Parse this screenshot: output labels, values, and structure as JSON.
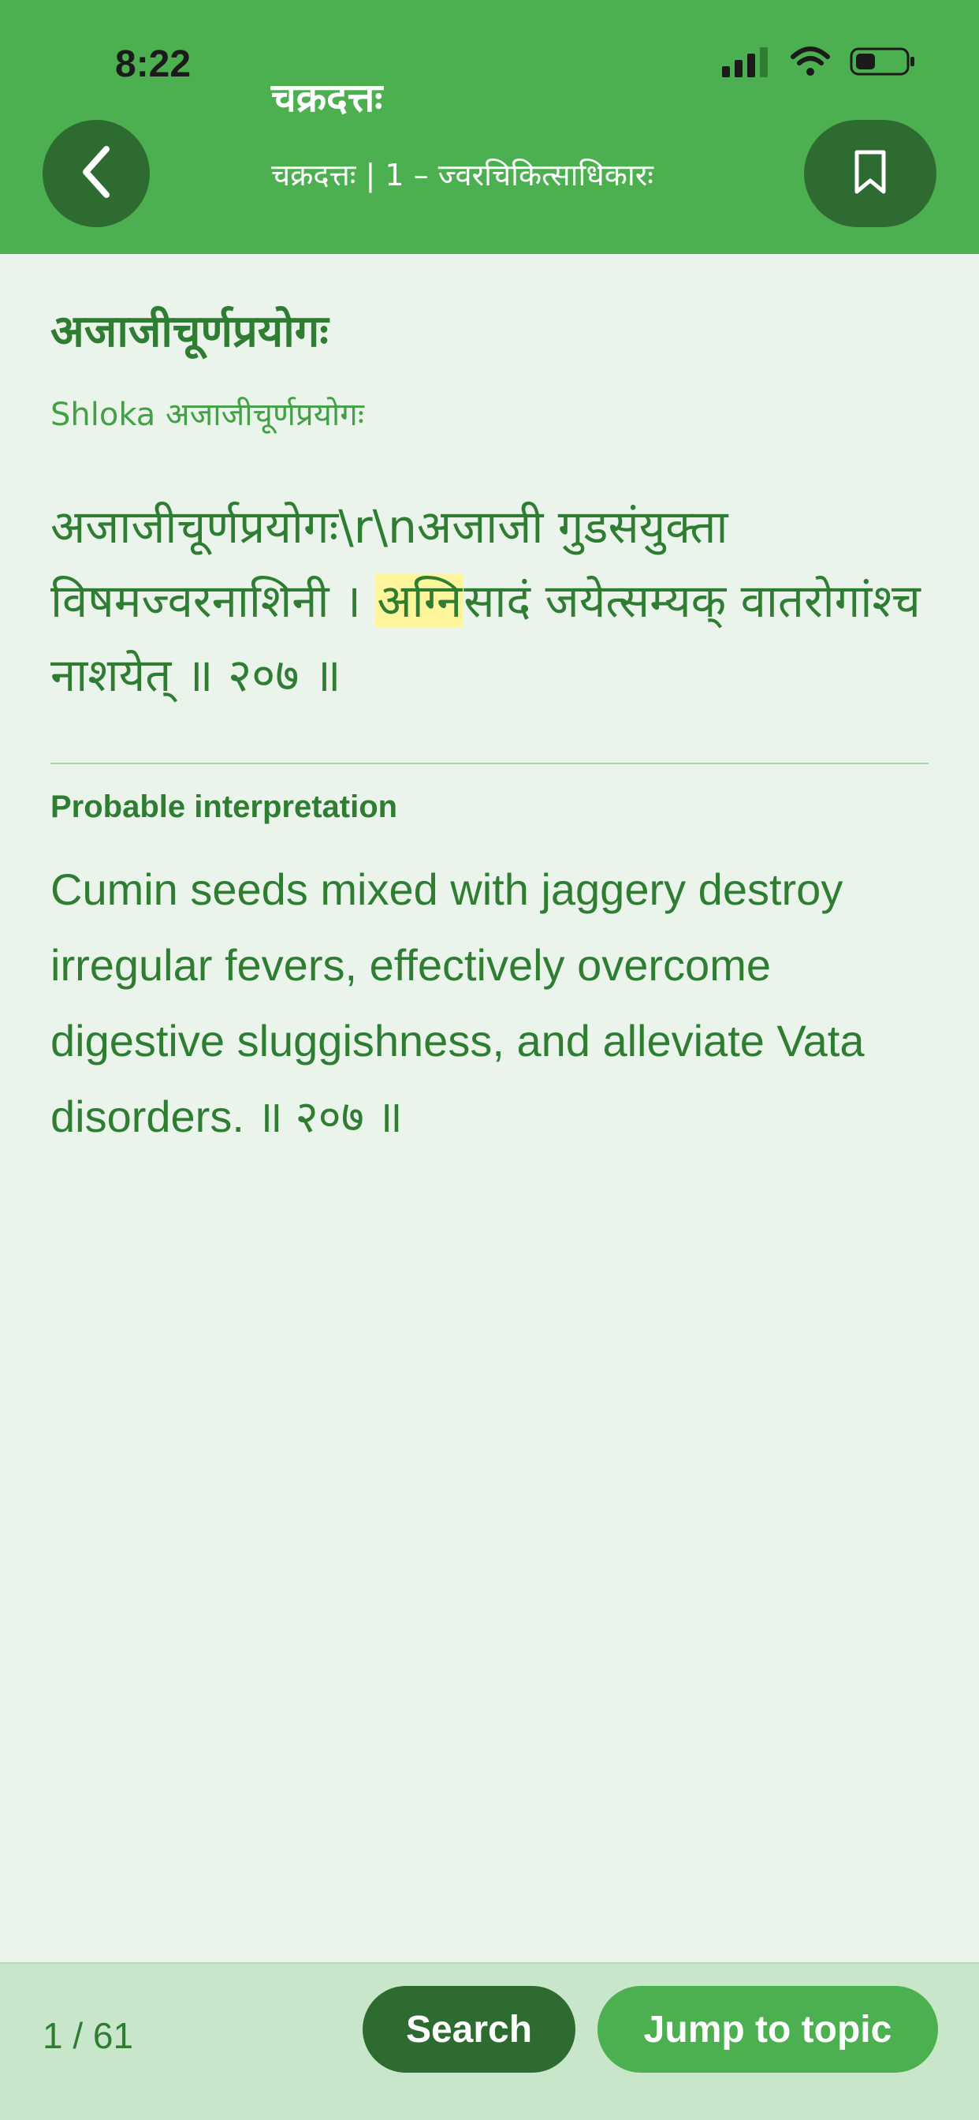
{
  "status_bar": {
    "time": "8:22",
    "icons": [
      "cellular-signal-icon",
      "wifi-icon",
      "battery-icon"
    ]
  },
  "header": {
    "title": "चक्रदत्तः",
    "subtitle": "चक्रदत्तः | 1 – ज्वरचिकित्साधिकारः",
    "back_icon": "chevron-left-icon",
    "bookmark_icon": "bookmark-icon"
  },
  "content": {
    "topic_title": "अजाजीचूर्णप्रयोगः",
    "shloka_label": "Shloka अजाजीचूर्णप्रयोगः",
    "shloka_before": "अजाजीचूर्णप्रयोगः\\r\\nअजाजी गुडसंयुक्ता विषमज्वरनाशिनी । ",
    "shloka_highlight": "अग्नि",
    "shloka_after": "सादं जयेत्सम्यक् वातरोगांश्च नाशयेत् ॥ २०७ ॥",
    "interpretation_heading": "Probable interpretation",
    "interpretation_text": "Cumin seeds mixed with jaggery destroy irregular fevers, effectively overcome digestive sluggishness, and alleviate Vata disorders. ॥ २०७ ॥"
  },
  "footer": {
    "page_indicator": "1 / 61",
    "search_label": "Search",
    "jump_label": "Jump to topic"
  },
  "colors": {
    "header_bg": "#4caf50",
    "dark_green": "#2e6b30",
    "page_bg": "#eaf4ea",
    "text_green": "#2e7d32",
    "highlight": "#fff59d"
  }
}
